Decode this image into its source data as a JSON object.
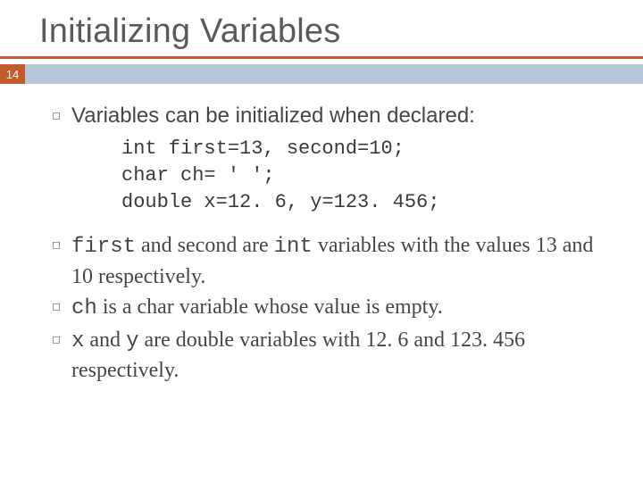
{
  "page_number": "14",
  "title": "Initializing Variables",
  "intro_bullet": "Variables can be initialized when declared:",
  "code": {
    "line1": "int first=13, second=10;",
    "line2": "char ch= ' ';",
    "line3": "double x=12. 6, y=123. 456;"
  },
  "bullets": {
    "b1": {
      "c_first": "first",
      "t1": " and second are ",
      "c_int": "int",
      "t2": " variables with the values 13 and 10 respectively."
    },
    "b2": {
      "c_ch": "ch",
      "t1": " is a char variable whose value is empty."
    },
    "b3": {
      "c_x": "x",
      "t_and": " and ",
      "c_y": "y",
      "t1": " are double variables with 12. 6 and 123. 456 respectively."
    }
  }
}
